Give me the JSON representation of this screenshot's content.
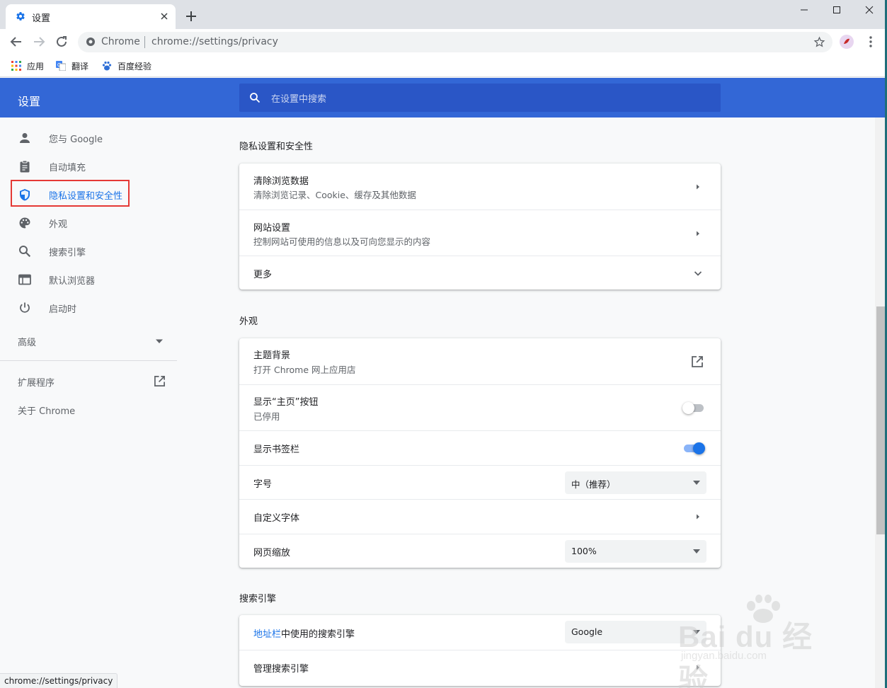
{
  "browser": {
    "tab_title": "设置",
    "omnibox_site": "Chrome",
    "omnibox_url": "chrome://settings/privacy",
    "bookmarks": [
      "应用",
      "翻译",
      "百度经验"
    ],
    "status_url": "chrome://settings/privacy"
  },
  "header": {
    "title": "设置",
    "search_placeholder": "在设置中搜索"
  },
  "sidebar": {
    "items": [
      {
        "label": "您与 Google",
        "icon": "person-icon"
      },
      {
        "label": "自动填充",
        "icon": "clipboard-icon"
      },
      {
        "label": "隐私设置和安全性",
        "icon": "shield-icon",
        "active": true
      },
      {
        "label": "外观",
        "icon": "palette-icon"
      },
      {
        "label": "搜索引擎",
        "icon": "search-icon"
      },
      {
        "label": "默认浏览器",
        "icon": "browser-icon"
      },
      {
        "label": "启动时",
        "icon": "power-icon"
      }
    ],
    "advanced": "高级",
    "extensions": "扩展程序",
    "about": "关于 Chrome"
  },
  "privacy": {
    "title": "隐私设置和安全性",
    "rows": [
      {
        "title": "清除浏览数据",
        "sub": "清除浏览记录、Cookie、缓存及其他数据"
      },
      {
        "title": "网站设置",
        "sub": "控制网站可使用的信息以及可向您显示的内容"
      },
      {
        "title": "更多"
      }
    ]
  },
  "appearance": {
    "title": "外观",
    "theme_title": "主题背景",
    "theme_sub": "打开 Chrome 网上应用店",
    "home_title": "显示“主页”按钮",
    "home_sub": "已停用",
    "home_enabled": false,
    "bookmarks_title": "显示书签栏",
    "bookmarks_enabled": true,
    "font_size_title": "字号",
    "font_size_value": "中（推荐）",
    "custom_fonts_title": "自定义字体",
    "zoom_title": "网页缩放",
    "zoom_value": "100%"
  },
  "search_engine": {
    "title": "搜索引擎",
    "engine_link": "地址栏",
    "engine_title_rest": "中使用的搜索引擎",
    "engine_value": "Google",
    "manage_title": "管理搜索引擎"
  },
  "watermark": {
    "brand": "Bai du 经验",
    "url": "jingyan.baidu.com"
  },
  "colors": {
    "header": "#3367d6",
    "accent": "#1a73e8",
    "highlight": "#e53935"
  }
}
